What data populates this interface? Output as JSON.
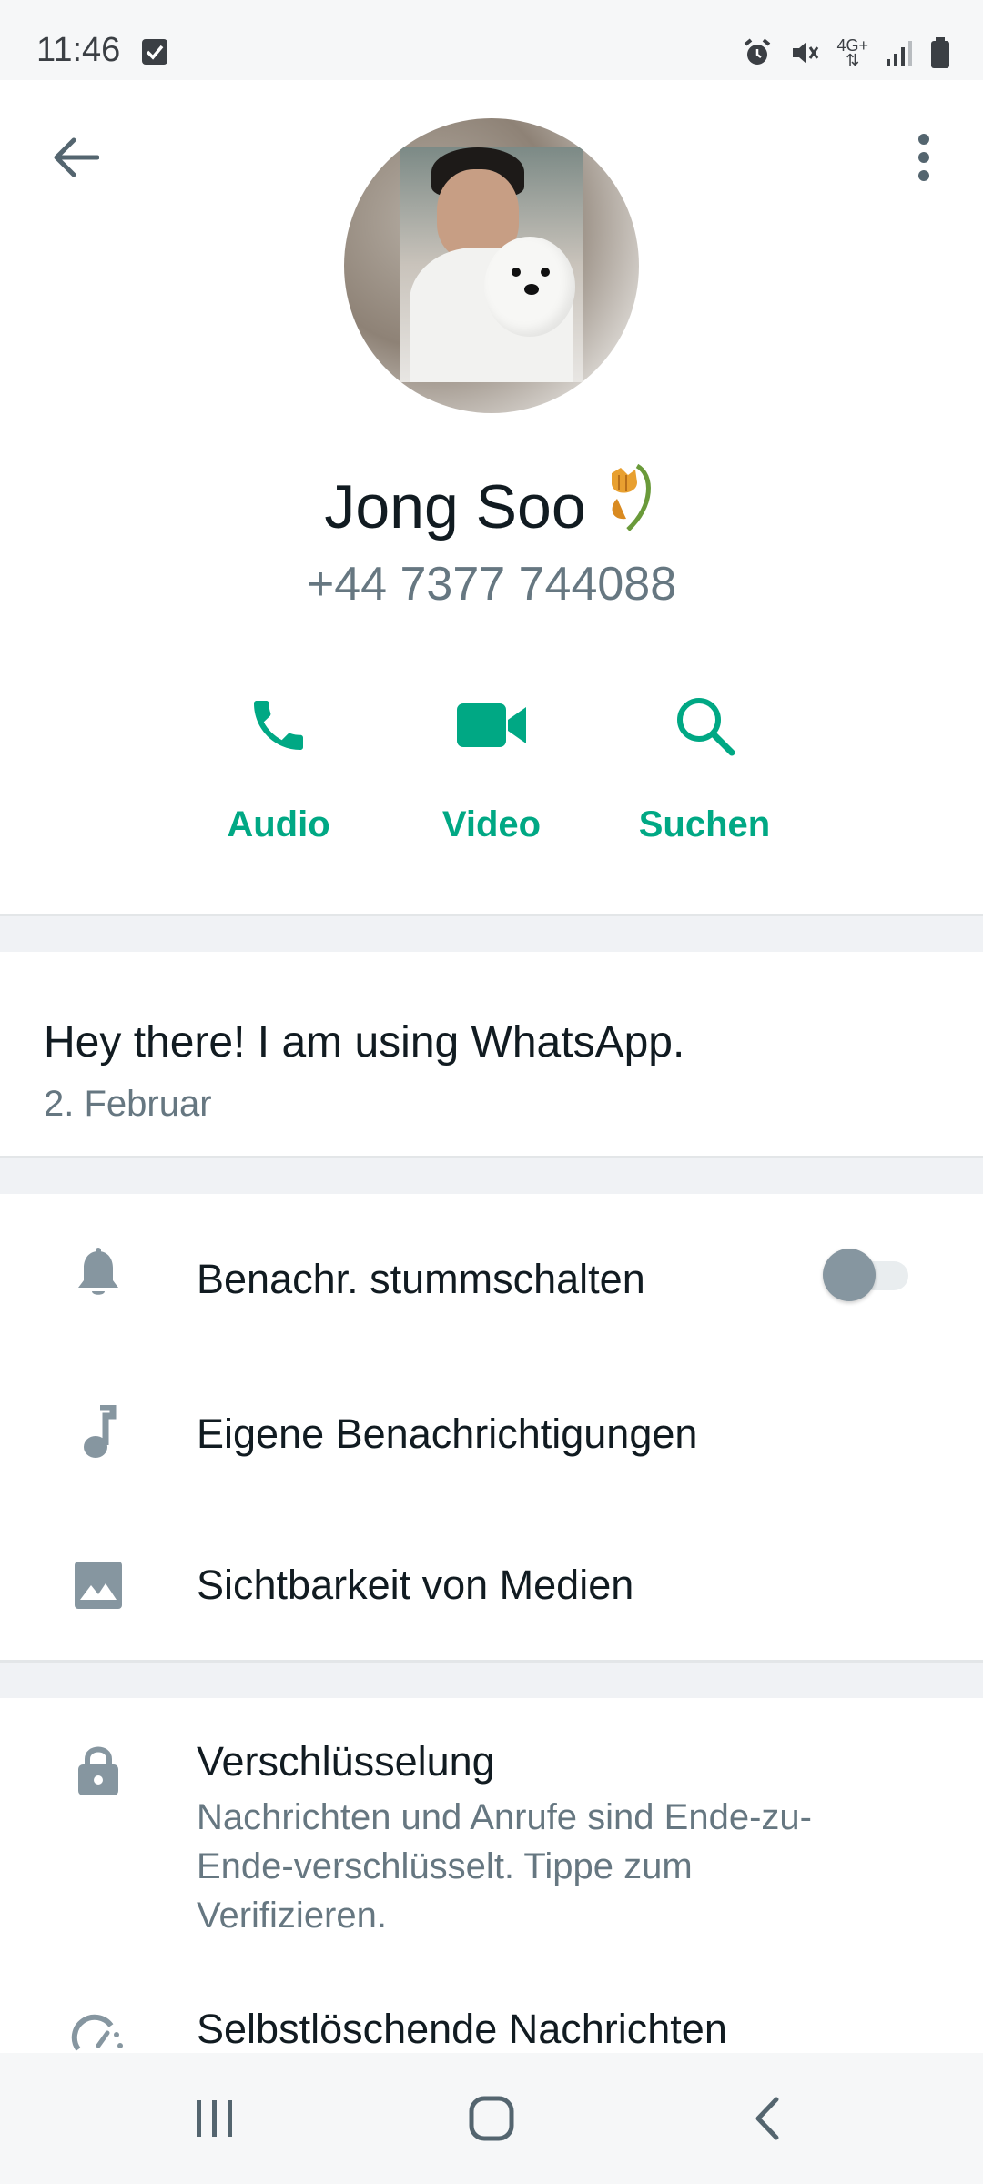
{
  "status_bar": {
    "time": "11:46",
    "network": "4G+"
  },
  "header": {
    "back_icon": "arrow-left-icon",
    "more_icon": "more-vertical-icon"
  },
  "contact": {
    "name": "Jong Soo",
    "phone": "+44 7377 744088"
  },
  "actions": [
    {
      "label": "Audio",
      "icon": "phone-icon"
    },
    {
      "label": "Video",
      "icon": "video-icon"
    },
    {
      "label": "Suchen",
      "icon": "search-icon"
    }
  ],
  "about": {
    "text": "Hey there! I am using WhatsApp.",
    "date": "2. Februar"
  },
  "settings": {
    "mute": {
      "label": "Benachr. stummschalten",
      "enabled": false
    },
    "custom_notifications": {
      "label": "Eigene Benachrichtigungen"
    },
    "media_visibility": {
      "label": "Sichtbarkeit von Medien"
    },
    "encryption": {
      "label": "Verschlüsselung",
      "sub": "Nachrichten und Anrufe sind Ende-zu-Ende-verschlüsselt. Tippe zum Verifizieren."
    },
    "disappearing": {
      "label": "Selbstlöschende Nachrichten"
    }
  },
  "colors": {
    "accent": "#00a884",
    "text_primary": "#111b21",
    "text_secondary": "#667781",
    "icon_gray": "#8696a0"
  }
}
